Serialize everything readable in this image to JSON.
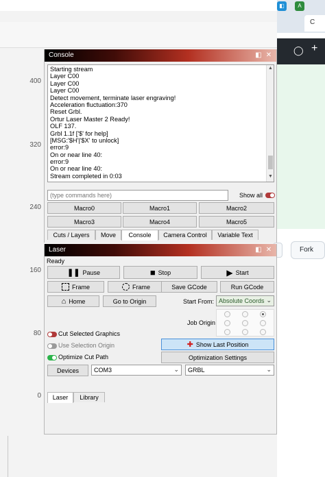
{
  "ruler": {
    "labels": [
      "400",
      "320",
      "240",
      "160",
      "80",
      "0"
    ]
  },
  "browser": {
    "tab_stub": "C",
    "fork_label": "Fork"
  },
  "console_panel": {
    "title": "Console",
    "log_lines": [
      "Starting stream",
      "Layer C00",
      "Layer C00",
      "Layer C00",
      "Detect movement, terminate laser engraving!",
      "Acceleration fluctuation:370",
      "Reset Grbl.",
      "Ortur Laser Master 2 Ready!",
      "OLF 137.",
      "Grbl 1.1f ['$' for help]",
      "[MSG:'$H'|'$X' to unlock]",
      "error:9",
      "On or near line 40:",
      "error:9",
      "On or near line 40:",
      "Stream completed in 0:03"
    ],
    "command_placeholder": "(type commands here)",
    "show_all_label": "Show all",
    "macros": [
      "Macro0",
      "Macro1",
      "Macro2",
      "Macro3",
      "Macro4",
      "Macro5"
    ],
    "tabs": [
      "Cuts / Layers",
      "Move",
      "Console",
      "Camera Control",
      "Variable Text"
    ],
    "active_tab": "Console"
  },
  "laser_panel": {
    "title": "Laser",
    "status": "Ready",
    "pause_label": "Pause",
    "stop_label": "Stop",
    "start_label": "Start",
    "frame_label": "Frame",
    "frame_round_label": "Frame",
    "save_gcode_label": "Save GCode",
    "run_gcode_label": "Run GCode",
    "home_label": "Home",
    "go_to_origin_label": "Go to Origin",
    "start_from_label": "Start From:",
    "start_from_value": "Absolute Coords",
    "job_origin_label": "Job Origin",
    "cut_selected_label": "Cut Selected Graphics",
    "use_selection_origin_label": "Use Selection Origin",
    "optimize_cut_path_label": "Optimize Cut Path",
    "show_last_position_label": "Show Last Position",
    "optimization_settings_label": "Optimization Settings",
    "devices_label": "Devices",
    "port_value": "COM3",
    "controller_value": "GRBL",
    "tabs": [
      "Laser",
      "Library"
    ],
    "active_tab": "Laser"
  },
  "colors": {
    "toggle_red": "#b03a3a",
    "toggle_grey": "#9a9a9a",
    "toggle_green": "#2bb34a",
    "highlight_blue": "#cce4f7"
  }
}
